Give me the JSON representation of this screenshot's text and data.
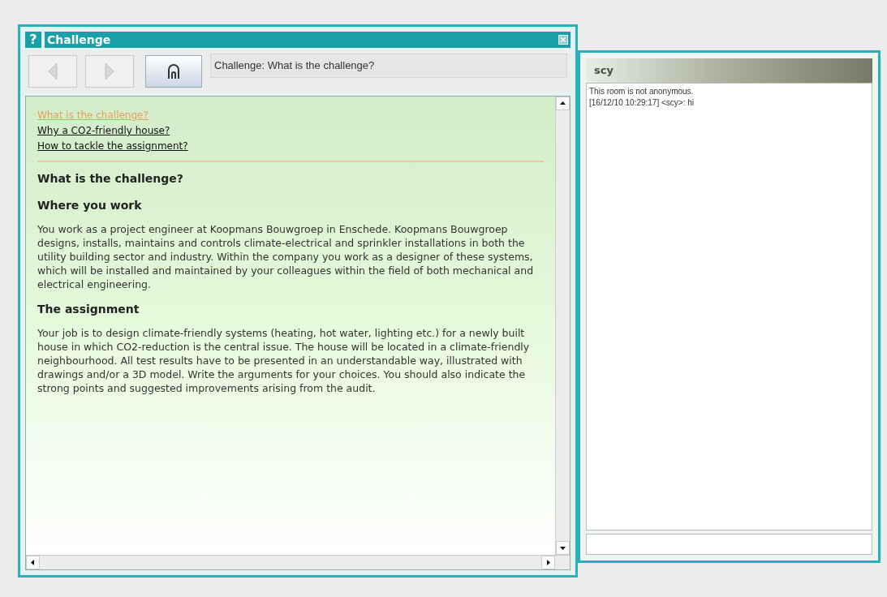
{
  "window": {
    "title": "Challenge",
    "help": "?"
  },
  "toolbar": {
    "back": {
      "disabled": true
    },
    "forward": {
      "disabled": true
    },
    "location": "Challenge: What is the challenge?"
  },
  "links": [
    {
      "label": "What is the challenge?",
      "selected": true
    },
    {
      "label": "Why a CO2-friendly house?",
      "selected": false
    },
    {
      "label": "How to tackle the assignment?",
      "selected": false
    }
  ],
  "content": [
    {
      "kind": "title",
      "text": "What is the challenge?"
    },
    {
      "kind": "heading",
      "text": "Where you work"
    },
    {
      "kind": "paragraph",
      "text": "You work as a project engineer at Koopmans Bouwgroep in Enschede. Koopmans Bouwgroep designs, installs, maintains and controls climate-electrical and sprinkler installations in both the utility building sector and industry. Within the company you work as a designer of these systems, which will be installed and maintained by your colleagues within the field of both mechanical and electrical engineering."
    },
    {
      "kind": "heading",
      "text": "The assignment"
    },
    {
      "kind": "paragraph",
      "text": "Your job is to design climate-friendly systems (heating, hot water, lighting etc.) for a newly built house in which CO2-reduction is the central issue. The house will be located in a climate-friendly neighbourhood. All test results have to be presented in an understandable way, illustrated with drawings and/or a 3D model. Write the arguments for your choices. You should also indicate the strong points and suggested improvements arising from the audit."
    }
  ],
  "chat": {
    "title": "scy",
    "messages": [
      "This room is not anonymous.",
      "[16/12/10 10:29:17] <scy>: hi"
    ]
  }
}
